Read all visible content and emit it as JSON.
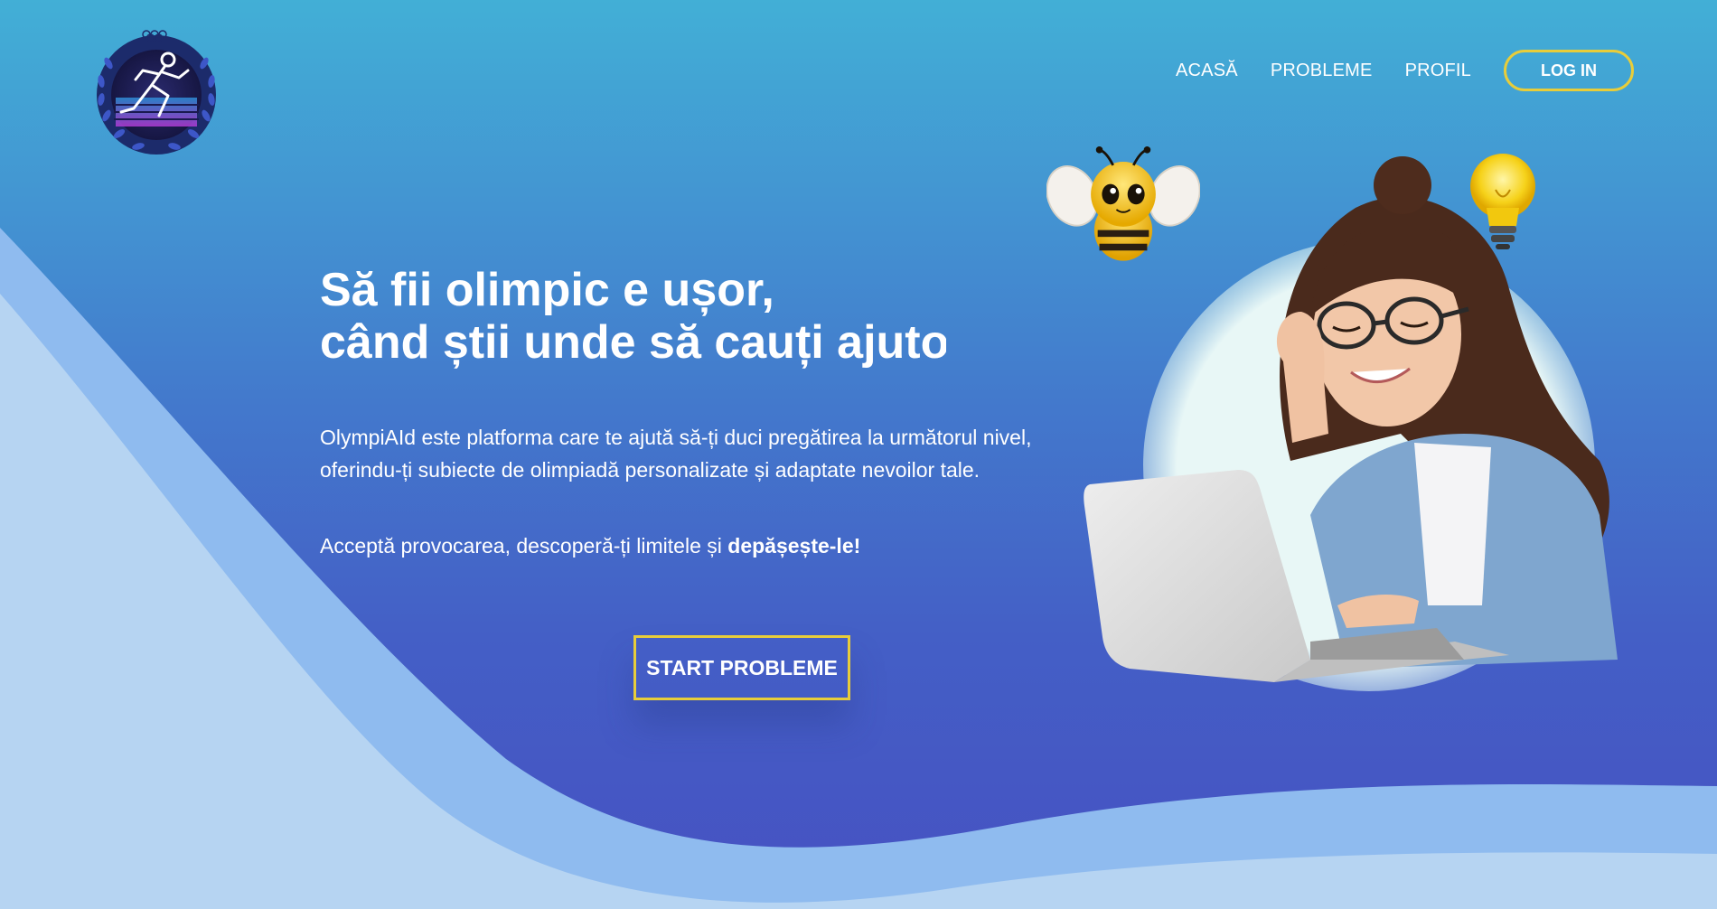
{
  "nav": {
    "home": "ACASĂ",
    "problems": "PROBLEME",
    "profile": "PROFIL",
    "login": "LOG IN"
  },
  "hero": {
    "headline_line1": "Să fii olimpic e ușor,",
    "headline_line2": "când știi unde să cauți ajutor",
    "description_line1": "OlympiAId este platforma care te ajută să-ți duci pregătirea la următorul nivel,",
    "description_line2": "oferindu-ți subiecte de olimpiadă personalizate și adaptate nevoilor tale.",
    "tagline_prefix": "Acceptă provocarea, descoperă-ți limitele și ",
    "tagline_bold": "depășește-le!",
    "cta": "START PROBLEME"
  },
  "colors": {
    "accent": "#e8cd3a",
    "bg_top": "#42afd6",
    "bg_bottom": "#4651c2",
    "wave_mid": "#8fbbef",
    "wave_light": "#b6d4f2"
  },
  "icons": {
    "logo": "olympic-runner-laurel-logo",
    "bee": "bee-mascot",
    "bulb": "lightbulb-icon"
  }
}
